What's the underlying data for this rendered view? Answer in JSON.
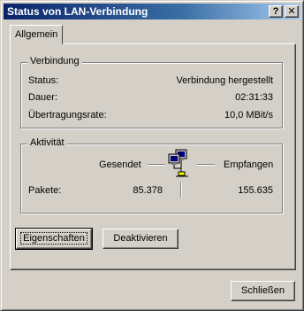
{
  "window": {
    "title": "Status von LAN-Verbindung",
    "help_label": "?",
    "close_label": "✕"
  },
  "tabs": [
    {
      "label": "Allgemein",
      "selected": true
    }
  ],
  "connection": {
    "group_title": "Verbindung",
    "status_label": "Status:",
    "status_value": "Verbindung hergestellt",
    "duration_label": "Dauer:",
    "duration_value": "02:31:33",
    "rate_label": "Übertragungsrate:",
    "rate_value": "10,0 MBit/s"
  },
  "activity": {
    "group_title": "Aktivität",
    "sent_label": "Gesendet",
    "received_label": "Empfangen",
    "packets_label": "Pakete:",
    "packets_sent": "85.378",
    "packets_received": "155.635",
    "icon": "network-computers-icon"
  },
  "buttons": {
    "properties": "Eigenschaften",
    "disable": "Deaktivieren",
    "close": "Schließen"
  },
  "colors": {
    "face": "#d4d0c8",
    "title_active": "#0a246a",
    "title_gradient_end": "#a6caf0"
  }
}
